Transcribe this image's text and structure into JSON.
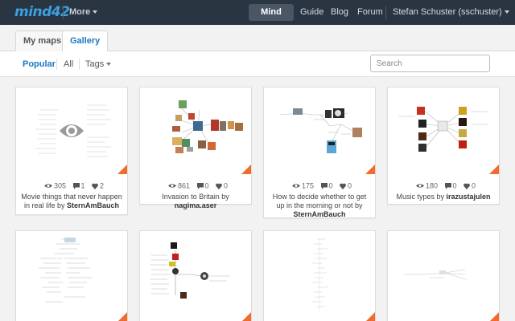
{
  "app": {
    "logo": "mind42"
  },
  "nav": {
    "more_label": "More",
    "mindmaps_label": "Mind maps",
    "guide_label": "Guide",
    "blog_label": "Blog",
    "forum_label": "Forum",
    "user_label": "Stefan Schuster (sschuster)"
  },
  "tabs": {
    "mymaps": "My maps",
    "gallery": "Gallery"
  },
  "filters": {
    "popular": "Popular",
    "all": "All",
    "tags": "Tags",
    "search_placeholder": "Search"
  },
  "colors": {
    "accent": "#1a78c2",
    "topbar": "#2a3542",
    "corner": "#f26b2a"
  },
  "maps": [
    {
      "views": "305",
      "comments": "1",
      "likes": "2",
      "title": "Movie things that never happen in real life",
      "by": "by",
      "author": "SternAmBauch"
    },
    {
      "views": "861",
      "comments": "0",
      "likes": "0",
      "title": "Invasion to Britain",
      "by": "by",
      "author": "nagima.aser"
    },
    {
      "views": "175",
      "comments": "0",
      "likes": "0",
      "title": "How to decide whether to get up in the morning or not",
      "by": "by",
      "author": "SternAmBauch"
    },
    {
      "views": "180",
      "comments": "0",
      "likes": "0",
      "title": "Music types",
      "by": "by",
      "author": "irazustajulen"
    }
  ]
}
